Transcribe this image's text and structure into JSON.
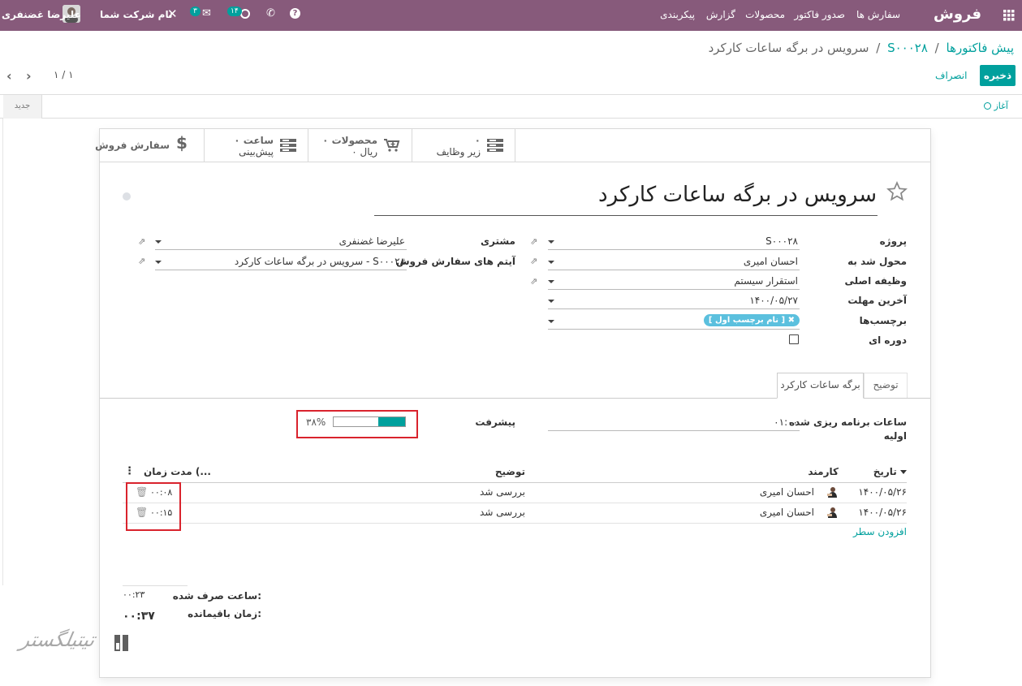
{
  "topbar": {
    "app_name": "فروش",
    "menu": [
      "سفارش ها",
      "صدور فاکتور",
      "محصولات",
      "گزارش",
      "پیکربندی"
    ],
    "user_name": "علیرضا غضنفری",
    "company_name": "نام شرکت شما",
    "activities_count": "۱۴",
    "messages_count": "۳",
    "bg_color": "#875a7b"
  },
  "breadcrumb": {
    "root": "پیش فاکتورها",
    "order": "S۰۰۰۲۸",
    "current": "سرویس در برگه ساعات کارکرد",
    "sep": "/"
  },
  "controls": {
    "save_label": "ذخیره",
    "discard_label": "انصراف",
    "pager": "۱ / ۱"
  },
  "statusbar": {
    "start_label": "آغاز",
    "new_label": "جدید"
  },
  "smart_buttons": [
    {
      "value": "۰",
      "label": "زیر وظایف",
      "icon": "tasks-icon"
    },
    {
      "value": "۰ محصولات",
      "label": "۰ ریال",
      "icon": "cart-plus-icon"
    },
    {
      "value": "۰ ساعت",
      "label": "پیش‌بینی",
      "icon": "tasks-icon"
    },
    {
      "value": "",
      "label": "سفارش فروش",
      "icon": "dollar-icon"
    }
  ],
  "task": {
    "title": "سرویس در برگه ساعات کارکرد"
  },
  "fields": {
    "project_label": "پروژه",
    "project": "S۰۰۰۲۸",
    "assigned_label": "محول شد به",
    "assigned": "احسان امیری",
    "parent_label": "وظیفه اصلی",
    "parent": "استقرار سیستم",
    "deadline_label": "آخرین مهلت",
    "deadline": "۱۴۰۰/۰۵/۲۷",
    "tags_label": "برچسب‌ها",
    "tag": "[ نام برچسب اول ]",
    "recurring_label": "دوره ای",
    "customer_label": "مشتری",
    "customer": "علیرضا غضنفری",
    "so_item_label": "آیتم های سفارش فروش",
    "so_item": "S۰۰۰۲۸ - سرویس در برگه ساعات کارکرد"
  },
  "tabs": [
    "برگه ساعات کارکرد",
    "توضیح"
  ],
  "timesheet": {
    "planned_label": "ساعات برنامه ریزی شده",
    "planned_label2": "اولیه",
    "planned_value": "۰۱:۰۰",
    "progress_label": "پیشرفت",
    "progress_text": "۳۸%",
    "progress_percent": 38,
    "columns": [
      "تاریخ",
      "کارمند",
      "توضیح",
      "مدت زمان (..."
    ],
    "rows": [
      {
        "date": "۱۴۰۰/۰۵/۲۶",
        "employee": "احسان امیری",
        "desc": "بررسی شد",
        "duration": "۰۰:۰۸"
      },
      {
        "date": "۱۴۰۰/۰۵/۲۶",
        "employee": "احسان امیری",
        "desc": "بررسی شد",
        "duration": "۰۰:۱۵"
      }
    ],
    "add_line": "افزودن سطر",
    "spent_label": "ساعت صرف شده:",
    "spent_value": "۰۰:۲۳",
    "remaining_label": "زمان باقیمانده:",
    "remaining_value": "۰۰:۳۷"
  },
  "watermark": "تیتیلگستر"
}
